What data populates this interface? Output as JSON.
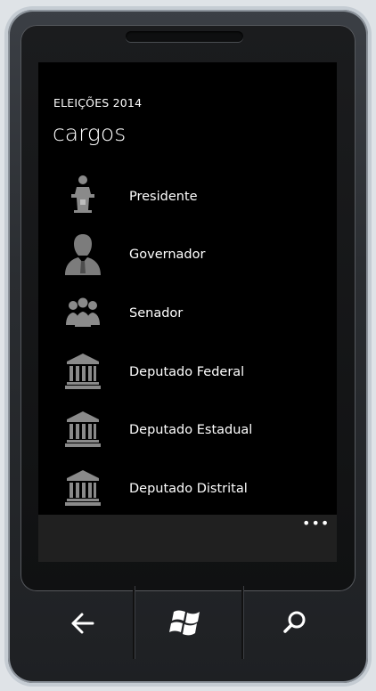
{
  "app": {
    "title": "ELEIÇÕES 2014",
    "page_title": "cargos"
  },
  "items": [
    {
      "label": "Presidente",
      "icon": "president-podium-icon"
    },
    {
      "label": "Governador",
      "icon": "person-bust-icon"
    },
    {
      "label": "Senador",
      "icon": "group-of-people-icon"
    },
    {
      "label": "Deputado Federal",
      "icon": "capitol-building-icon"
    },
    {
      "label": "Deputado Estadual",
      "icon": "capitol-building-icon"
    },
    {
      "label": "Deputado Distrital",
      "icon": "capitol-building-icon"
    }
  ],
  "appbar": {
    "more_label": "•••"
  },
  "hardware_buttons": [
    "back-arrow-icon",
    "windows-logo-icon",
    "search-icon"
  ],
  "colors": {
    "screen": "#000000",
    "text": "#ffffff",
    "icon": "#8a8a8a",
    "appbar": "#202020"
  }
}
